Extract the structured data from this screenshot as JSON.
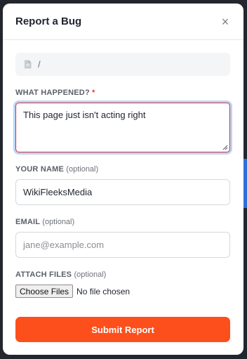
{
  "modal": {
    "title": "Report a Bug",
    "close_icon": "close-icon",
    "close_glyph": "×"
  },
  "path_bar": {
    "icon": "file-icon",
    "text": "/"
  },
  "what_happened": {
    "label": "WHAT HAPPENED?",
    "required_mark": "*",
    "value": "This page just isn't acting right"
  },
  "your_name": {
    "label": "YOUR NAME",
    "optional": "(optional)",
    "value": "WikiFleeksMedia"
  },
  "email": {
    "label": "EMAIL",
    "optional": "(optional)",
    "placeholder": "jane@example.com"
  },
  "attach_files": {
    "label": "ATTACH FILES",
    "optional": "(optional)",
    "button": "Choose Files",
    "status": "No file chosen"
  },
  "submit": {
    "label": "Submit Report"
  },
  "colors": {
    "accent": "#fd4f1b",
    "focus_ring": "#bfd4f4",
    "error_border": "#c9353a"
  }
}
